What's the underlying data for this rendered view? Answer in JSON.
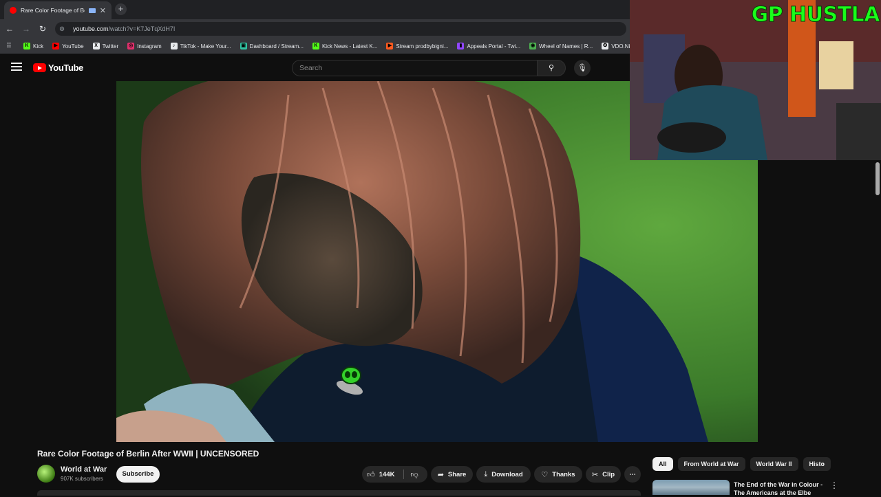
{
  "browser": {
    "tab_title": "Rare Color Footage of Berlin",
    "tab_close": "✕",
    "new_tab": "+",
    "url_host": "youtube.com",
    "url_path": "/watch?v=K7JeTqXdH7I",
    "bookmarks": [
      {
        "label": "Kick",
        "icon": "kick-icon",
        "color": "#53fc18",
        "glyph": "K"
      },
      {
        "label": "YouTube",
        "icon": "youtube-icon",
        "color": "#ff0000",
        "glyph": "▶"
      },
      {
        "label": "Twitter",
        "icon": "x-icon",
        "color": "#e8eaed",
        "glyph": "X"
      },
      {
        "label": "Instagram",
        "icon": "instagram-icon",
        "color": "#e1306c",
        "glyph": "◎"
      },
      {
        "label": "TikTok - Make Your...",
        "icon": "tiktok-icon",
        "color": "#e8eaed",
        "glyph": "♪"
      },
      {
        "label": "Dashboard / Stream...",
        "icon": "streamlabs-icon",
        "color": "#31c3a2",
        "glyph": "▣"
      },
      {
        "label": "Kick News - Latest K...",
        "icon": "kick-icon",
        "color": "#53fc18",
        "glyph": "K"
      },
      {
        "label": "Stream prodbybigni...",
        "icon": "stream-icon",
        "color": "#ff5a1f",
        "glyph": "▶"
      },
      {
        "label": "Appeals Portal - Twi...",
        "icon": "twitch-icon",
        "color": "#9146ff",
        "glyph": "▮"
      },
      {
        "label": "Wheel of Names | R...",
        "icon": "wheel-icon",
        "color": "#4caf50",
        "glyph": "◉"
      },
      {
        "label": "VDO.Ninja",
        "icon": "vdo-ninja-icon",
        "color": "#e8eaed",
        "glyph": "✪"
      }
    ]
  },
  "youtube": {
    "logo_text": "YouTube",
    "search_placeholder": "Search",
    "video": {
      "title": "Rare Color Footage of Berlin After WWII | UNCENSORED",
      "channel": "World at War",
      "subscribers": "907K subscribers",
      "subscribe_label": "Subscribe",
      "likes": "144K",
      "share_label": "Share",
      "download_label": "Download",
      "thanks_label": "Thanks",
      "clip_label": "Clip",
      "more_label": "⋯"
    },
    "chips": [
      "All",
      "From World at War",
      "World War II",
      "Histo"
    ],
    "recommendation": {
      "title": "The End of the War in Colour - The Americans at the Elbe"
    }
  },
  "webcam": {
    "streamer_name": "GP HUSTLA"
  }
}
